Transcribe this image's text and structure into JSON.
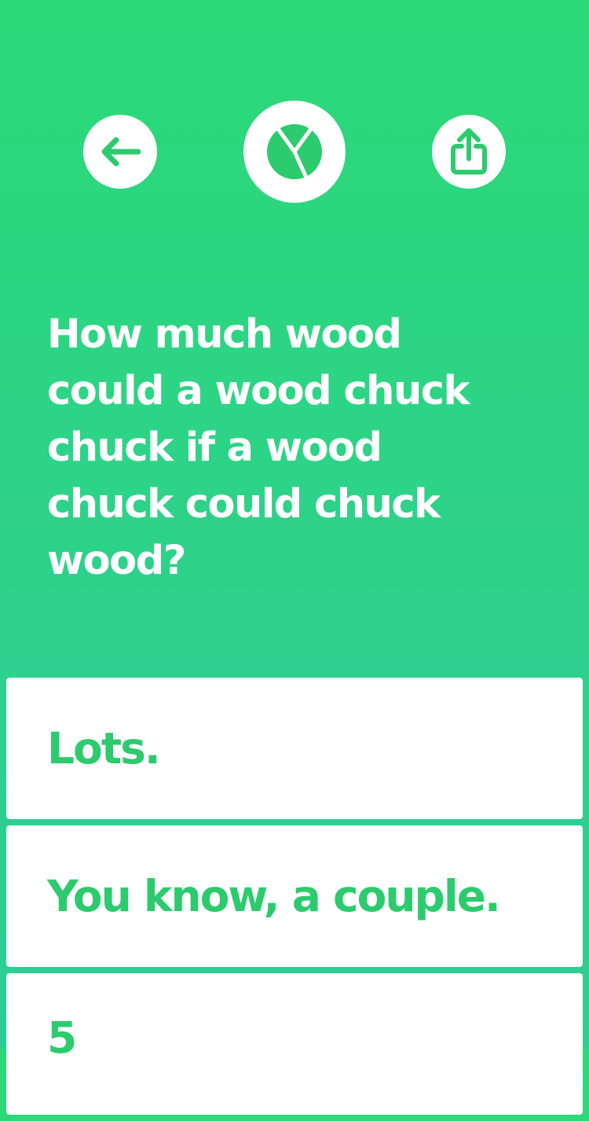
{
  "header": {
    "back_icon": "arrow-left-icon",
    "logo_icon": "app-logo-icon",
    "share_icon": "share-icon"
  },
  "colors": {
    "background_top": "#2cd978",
    "background_bottom": "#2dcd95",
    "accent": "#2ccb6e",
    "card": "#ffffff"
  },
  "question": {
    "text": "How much wood could a wood chuck chuck if a wood chuck could chuck wood?"
  },
  "answers": [
    {
      "label": "Lots."
    },
    {
      "label": "You know, a couple."
    },
    {
      "label": "5"
    }
  ]
}
